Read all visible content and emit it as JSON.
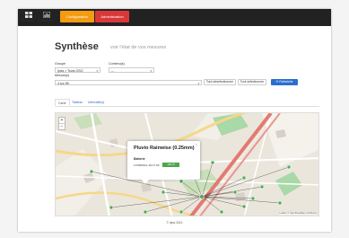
{
  "nav": {
    "items": [
      {
        "label": "Synthèse",
        "icon": "grid-icon"
      },
      {
        "label": "Historique",
        "icon": "chart-icon"
      }
    ],
    "tabs": [
      {
        "label": "Configuration",
        "color": "#f39c12"
      },
      {
        "label": "Administration",
        "color": "#d9383a"
      }
    ]
  },
  "header": {
    "title": "Synthèse",
    "subtitle": "voir l'état de vos mesures"
  },
  "filters": {
    "group_label": "Groupe",
    "group_value": "Ipisz > Tours OSO",
    "content_label": "Contenu(s)",
    "content_value": "---",
    "measure_label": "Mesure(s)",
    "measure_value": "4 sur 85",
    "deselect_all": "Tout désélectionner",
    "select_all": "Tout sélectionner",
    "refresh": "Rafraîchir"
  },
  "view_tabs": [
    "Carte",
    "Tableau",
    "Intervalle(s)"
  ],
  "map": {
    "zoom_in": "+",
    "zoom_out": "−",
    "attribution": "Leaflet | © OpenStreetMap contributors",
    "popup": {
      "title": "Pluvio Rainwise (0.25mm)",
      "close": "×",
      "section": "Batterie",
      "date": "17/08/2014, 09:17:09",
      "value": "100 %"
    }
  },
  "footer": {
    "text": "© Ipisz 2013"
  },
  "colors": {
    "topbar": "#222222",
    "primary": "#2a6fd0",
    "status_ok": "#49a84b",
    "marker": "#4caf50"
  }
}
